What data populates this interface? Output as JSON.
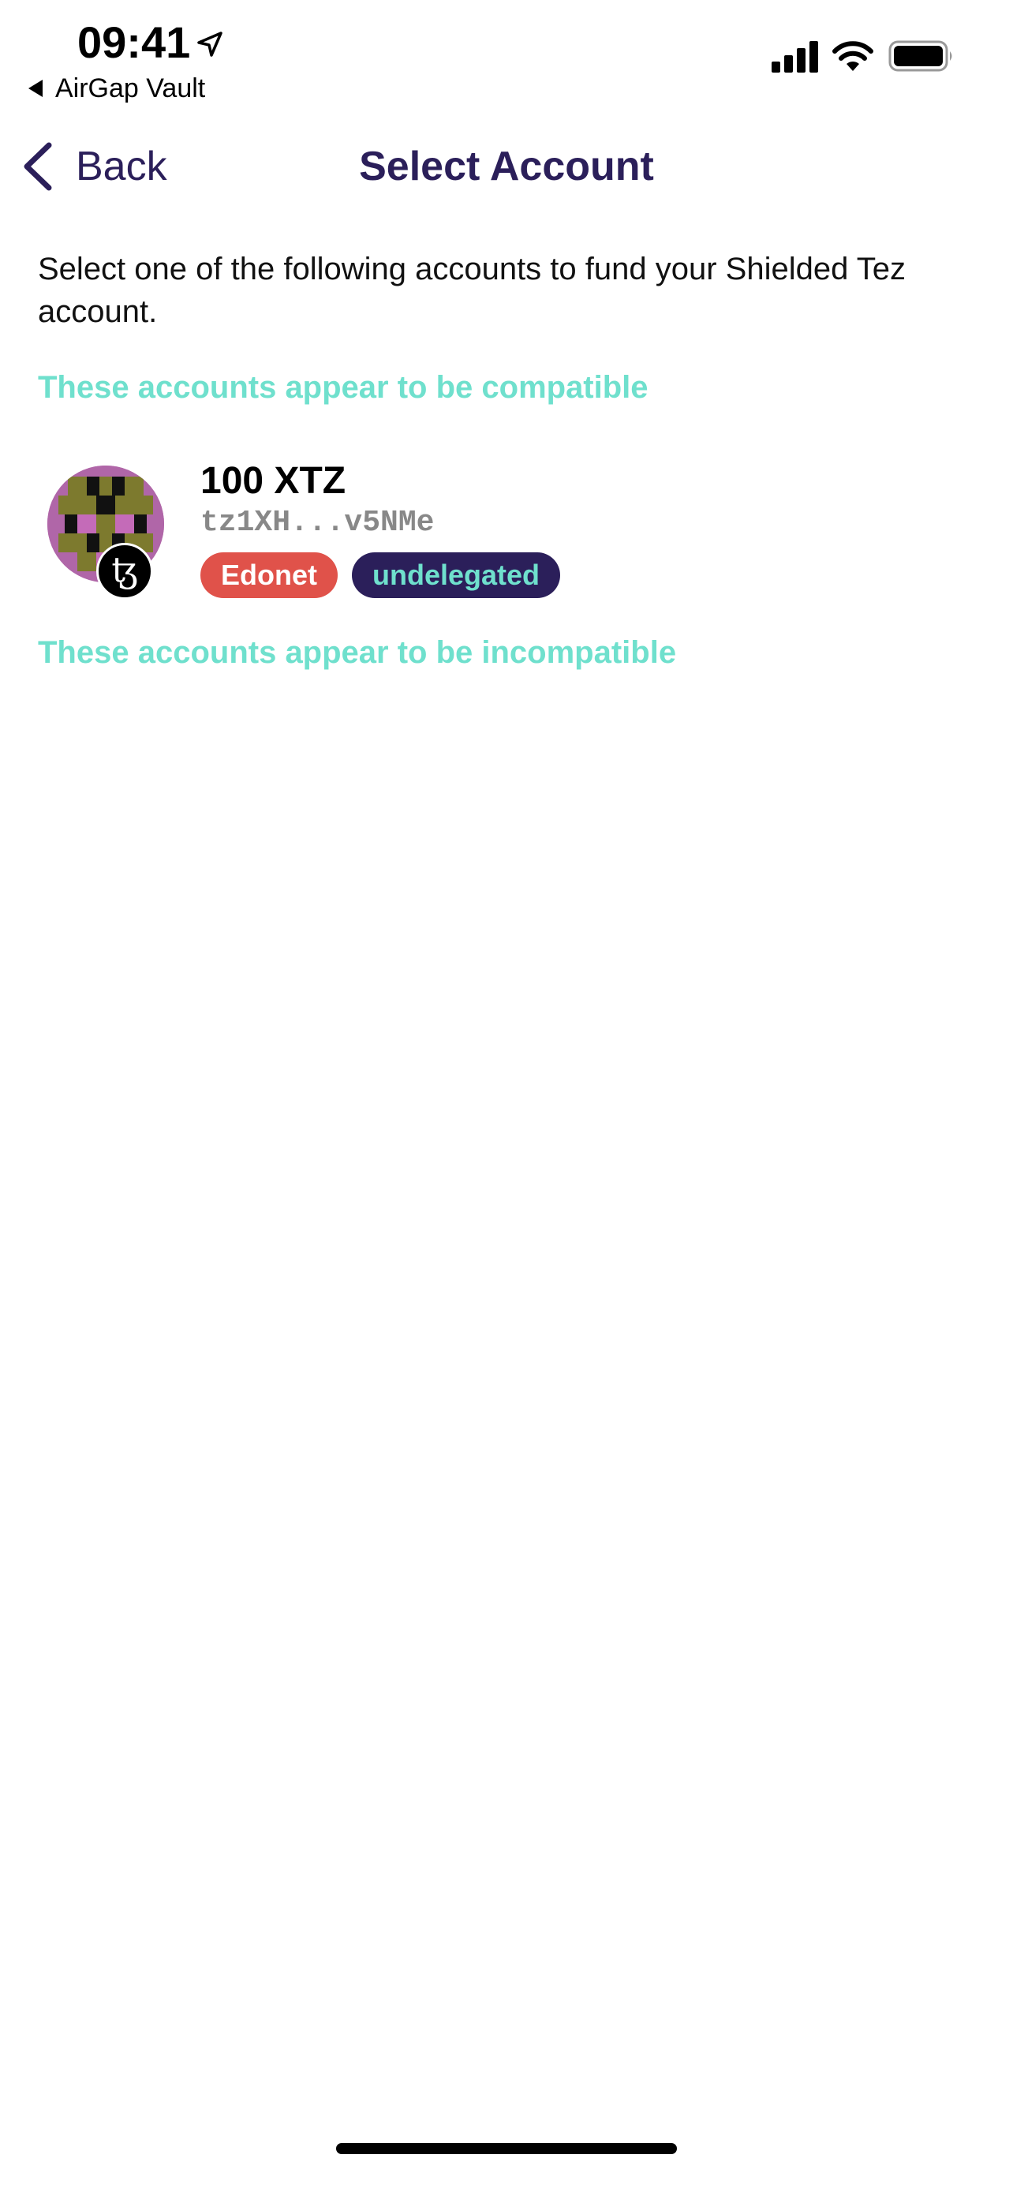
{
  "status_bar": {
    "time": "09:41",
    "back_app": "AirGap Vault"
  },
  "nav": {
    "back_label": "Back",
    "title": "Select Account"
  },
  "intro_text": "Select one of the following accounts to fund your Shielded Tez account.",
  "sections": {
    "compatible_label": "These accounts appear to be compatible",
    "incompatible_label": "These accounts appear to be incompatible"
  },
  "accounts": [
    {
      "amount": "100 XTZ",
      "address": "tz1XH...v5NMe",
      "network": "Edonet",
      "delegation": "undelegated",
      "protocol_icon": "tezos-icon"
    }
  ],
  "colors": {
    "primary": "#2b1f5a",
    "accent": "#6fe0cd",
    "network_badge": "#e0524a"
  }
}
